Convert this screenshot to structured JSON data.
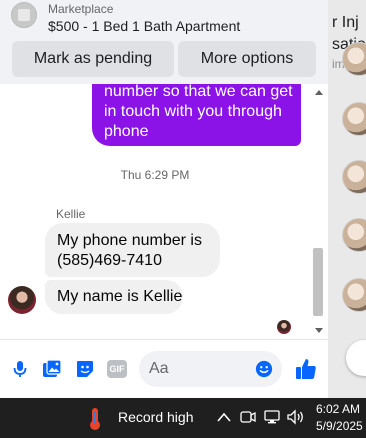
{
  "header": {
    "source": "Marketplace",
    "title": "$500 - 1 Bed 1 Bath Apartment",
    "buttons": {
      "pending": "Mark as pending",
      "more": "More options"
    }
  },
  "messages": {
    "sent": {
      "lines": [
        "number so that we can get",
        "in touch with you through",
        "phone"
      ]
    },
    "timestamp": "Thu 6:29 PM",
    "sender": "Kellie",
    "received": [
      {
        "lines": [
          "My phone number is",
          "(585)469-7410"
        ]
      },
      {
        "lines": [
          "My name is Kellie"
        ]
      }
    ]
  },
  "composer": {
    "gif_label": "GIF",
    "placeholder": "Aa"
  },
  "background_page": {
    "line1": "r Inj",
    "line2": "sation",
    "line3": "ima"
  },
  "taskbar": {
    "weather_text": "Record high",
    "time": "6:02 AM",
    "date": "5/9/2025"
  },
  "colors": {
    "accent": "#8b13e8",
    "messenger_blue": "#0866ff",
    "received_bubble": "#f0f0f0"
  }
}
